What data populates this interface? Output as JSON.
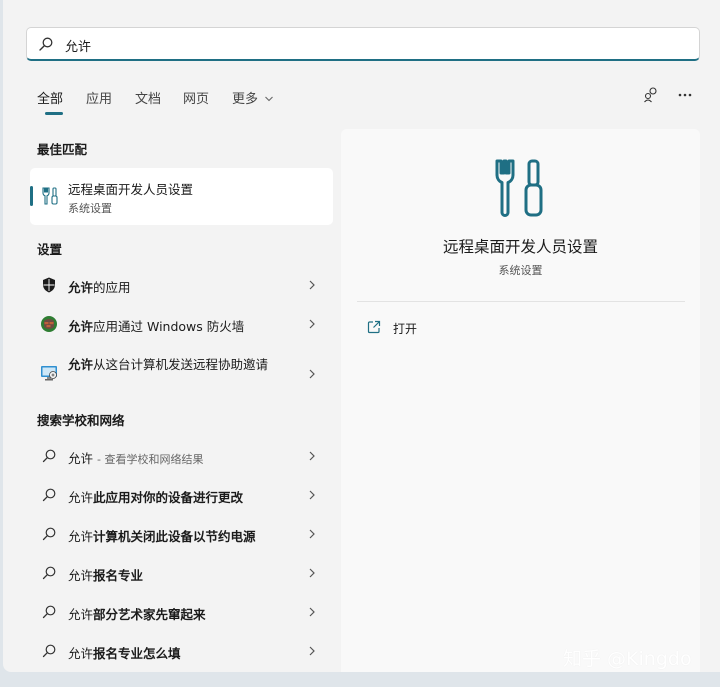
{
  "search": {
    "value": "允许"
  },
  "tabs": [
    {
      "label": "全部",
      "active": true
    },
    {
      "label": "应用"
    },
    {
      "label": "文档"
    },
    {
      "label": "网页"
    },
    {
      "label": "更多"
    }
  ],
  "best_match": {
    "header": "最佳匹配",
    "title": "远程桌面开发人员设置",
    "subtitle": "系统设置",
    "icon": "tools-icon"
  },
  "settings": {
    "header": "设置",
    "items": [
      {
        "bold": "允许",
        "rest": "的应用",
        "icon": "shield-icon"
      },
      {
        "bold": "允许",
        "rest": "应用通过 Windows 防火墙",
        "icon": "firewall-icon"
      },
      {
        "bold": "允许",
        "rest": "从这台计算机发送远程协助邀请",
        "icon": "remote-assist-icon"
      }
    ]
  },
  "web": {
    "header": "搜索学校和网络",
    "items": [
      {
        "text": "允许",
        "hint": "- 查看学校和网络结果"
      },
      {
        "prefix": "允许",
        "bold": "此应用对你的设备进行更改"
      },
      {
        "prefix": "允许",
        "bold": "计算机关闭此设备以节约电源"
      },
      {
        "prefix": "允许",
        "bold": "报名专业"
      },
      {
        "prefix": "允许",
        "bold": "部分艺术家先窜起来"
      },
      {
        "prefix": "允许",
        "bold": "报名专业怎么填"
      }
    ]
  },
  "detail": {
    "title": "远程桌面开发人员设置",
    "subtitle": "系统设置",
    "open_label": "打开"
  },
  "watermark": "知乎 @Kingdo",
  "colors": {
    "accent": "#1f6f84"
  }
}
